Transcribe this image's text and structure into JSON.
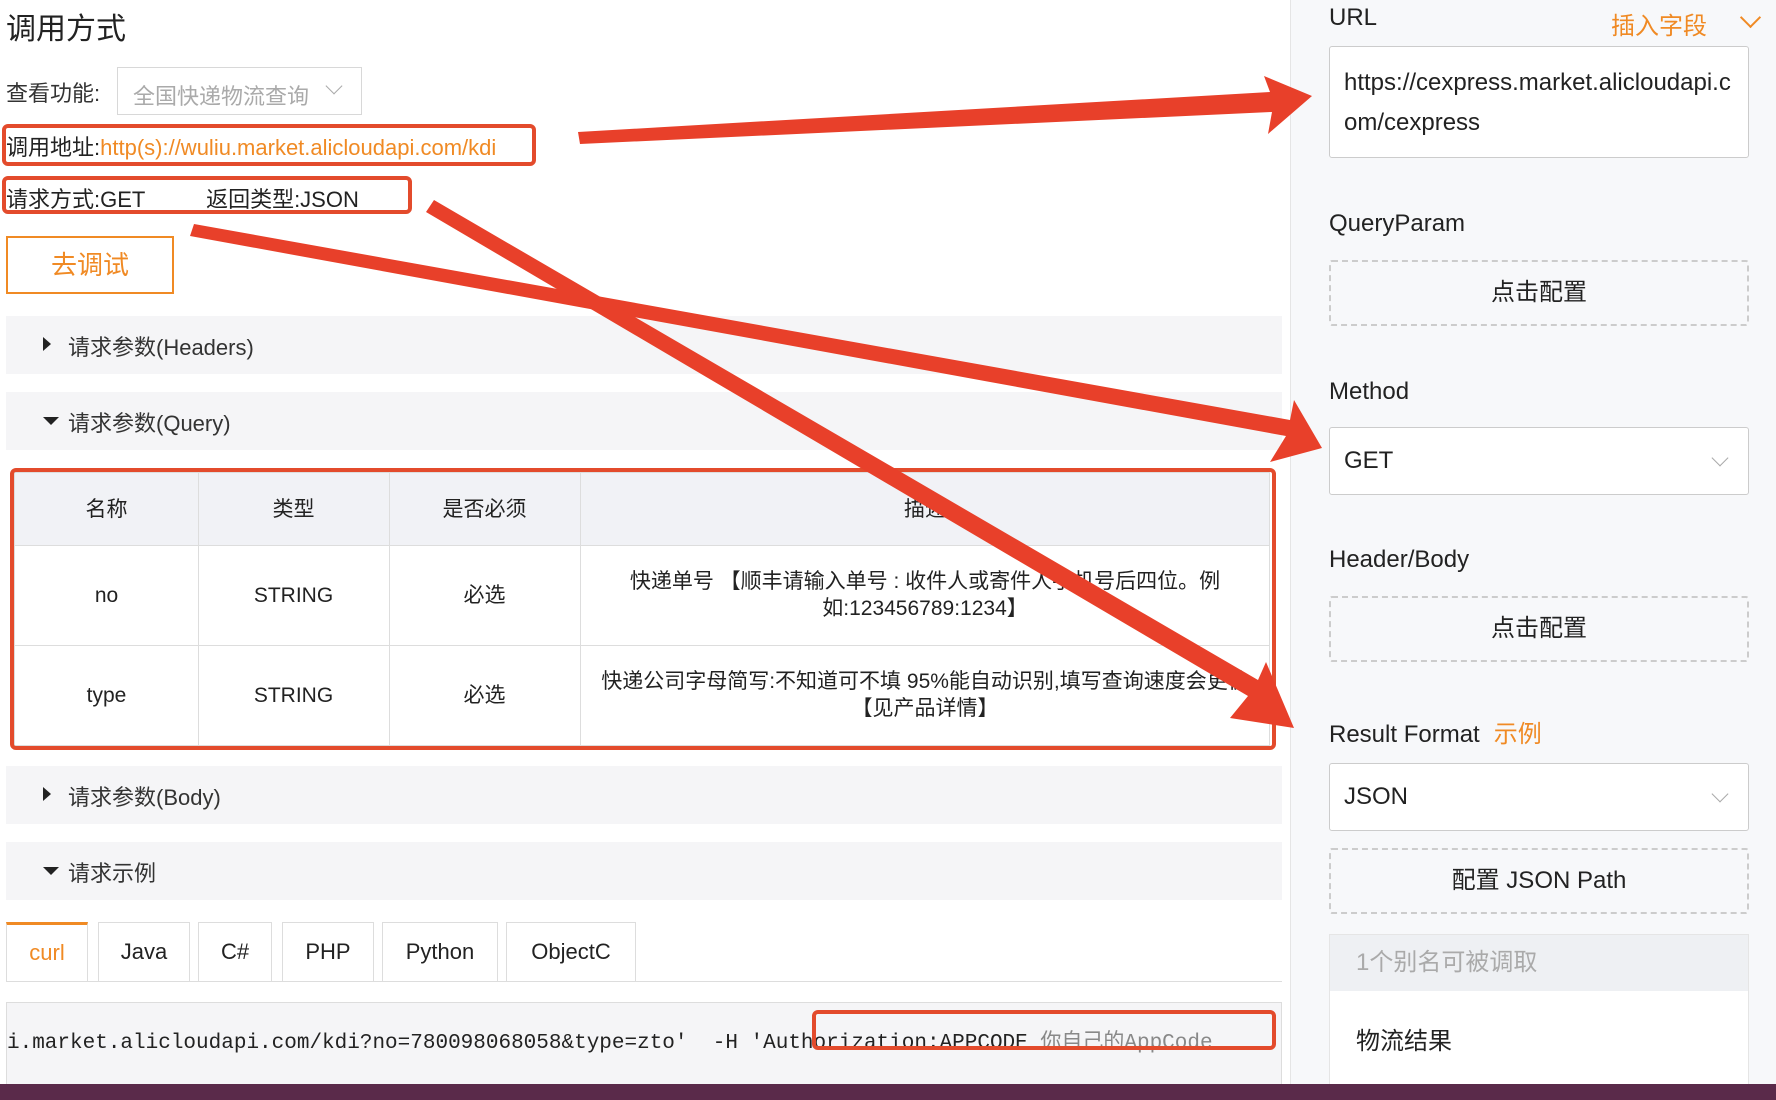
{
  "left": {
    "title": "调用方式",
    "function_label": "查看功能:",
    "function_select_value": "全国快递物流查询",
    "url_label": "调用地址:",
    "url_value": "http(s)://wuliu.market.alicloudapi.com/kdi",
    "method_line": "请求方式:GET          返回类型:JSON",
    "debug_button": "去调试",
    "sections": {
      "headers": "请求参数(Headers)",
      "query": "请求参数(Query)",
      "body": "请求参数(Body)",
      "example": "请求示例"
    },
    "query_table": {
      "headers": [
        "名称",
        "类型",
        "是否必须",
        "描述"
      ],
      "rows": [
        [
          "no",
          "STRING",
          "必选",
          "快递单号 【顺丰请输入单号 : 收件人或寄件人手机号后四位。例如:123456789:1234】"
        ],
        [
          "type",
          "STRING",
          "必选",
          "快递公司字母简写:不知道可不填 95%能自动识别,填写查询速度会更快【见产品详情】"
        ]
      ]
    },
    "tabs": [
      "curl",
      "Java",
      "C#",
      "PHP",
      "Python",
      "ObjectC"
    ],
    "active_tab": "curl",
    "code_main": "i.market.alicloudapi.com/kdi?no=780098068058&type=zto'  -H 'Authorization:APPCODE ",
    "code_placeholder": "你自己的AppCode"
  },
  "right": {
    "url_label": "URL",
    "insert_field": "插入字段",
    "url_value": "https://cexpress.market.alicloudapi.com/cexpress",
    "queryparam_label": "QueryParam",
    "configure_button": "点击配置",
    "method_label": "Method",
    "method_value": "GET",
    "headerbody_label": "Header/Body",
    "configure_button_2": "点击配置",
    "result_format_label": "Result Format",
    "example_link": "示例",
    "result_format_value": "JSON",
    "json_path_button": "配置 JSON Path",
    "alias_header": "1个别名可被调取",
    "alias_item": "物流结果"
  },
  "colors": {
    "accent": "#f08a24",
    "annotation_red": "#e34b2c",
    "panel_bg": "#f7f8fa",
    "section_bg": "#f5f5f7"
  }
}
